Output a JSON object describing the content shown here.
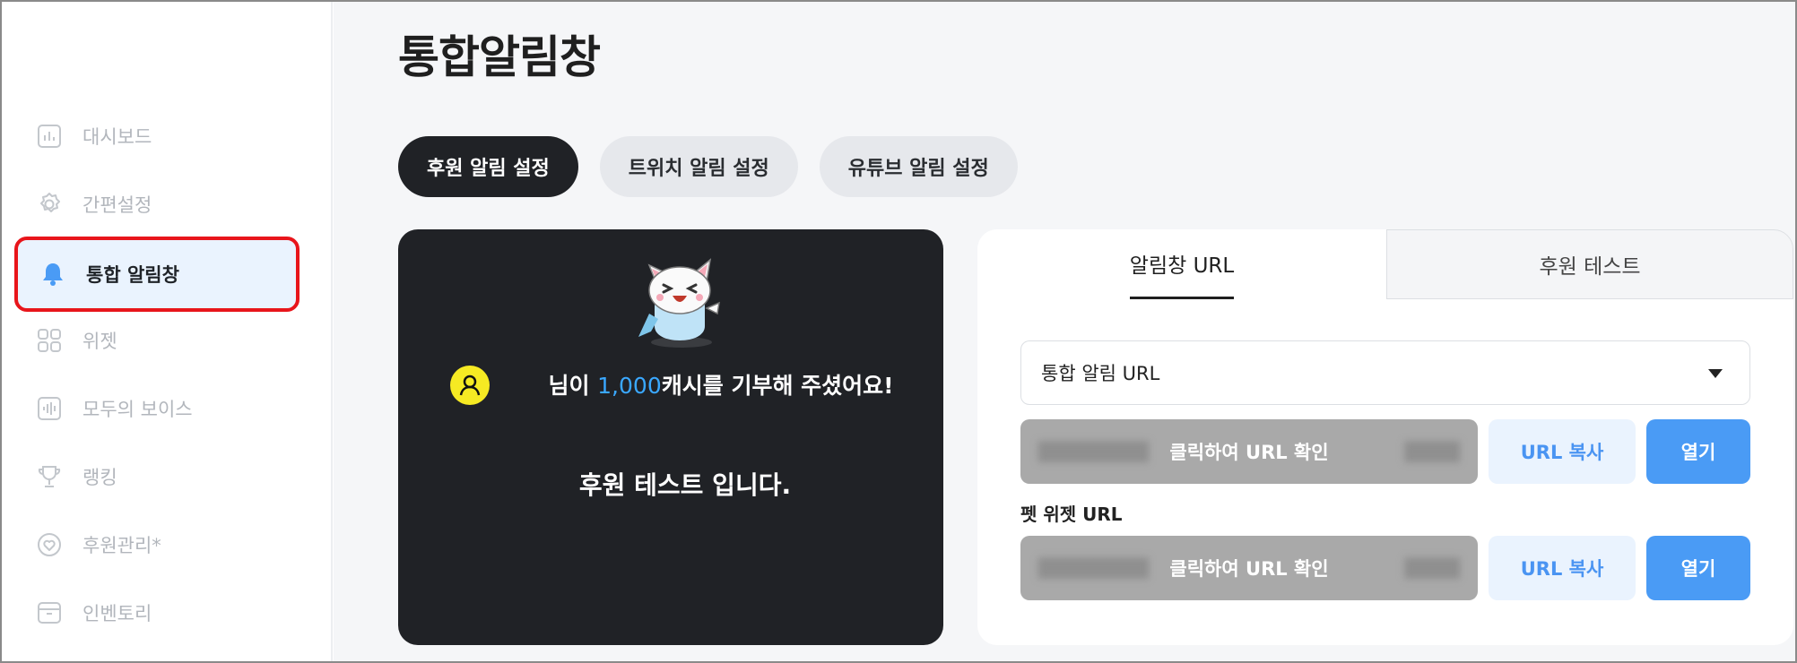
{
  "sidebar": {
    "items": [
      {
        "label": "대시보드",
        "icon": "chart-icon"
      },
      {
        "label": "간편설정",
        "icon": "gear-icon"
      },
      {
        "label": "통합 알림창",
        "icon": "bell-icon",
        "active": true
      },
      {
        "label": "위젯",
        "icon": "grid-icon"
      },
      {
        "label": "모두의 보이스",
        "icon": "audio-wave-icon"
      },
      {
        "label": "랭킹",
        "icon": "trophy-icon"
      },
      {
        "label": "후원관리*",
        "icon": "heart-icon"
      },
      {
        "label": "인벤토리",
        "icon": "box-icon"
      }
    ]
  },
  "main": {
    "title": "통합알림창",
    "tabs": [
      {
        "label": "후원 알림 설정",
        "active": true
      },
      {
        "label": "트위치 알림 설정",
        "active": false
      },
      {
        "label": "유튜브 알림 설정",
        "active": false
      }
    ]
  },
  "preview": {
    "message_prefix": "님이 ",
    "amount": "1,000",
    "message_suffix": "캐시를 기부해 주셨어요!",
    "test_message": "후원 테스트 입니다."
  },
  "panel": {
    "tabs": [
      {
        "label": "알림창 URL",
        "active": true
      },
      {
        "label": "후원 테스트",
        "active": false
      }
    ],
    "select_value": "통합 알림 URL",
    "url_overlay_label": "클릭하여 URL 확인",
    "copy_label": "URL 복사",
    "open_label": "열기",
    "pet_widget_label": "펫 위젯 URL"
  },
  "colors": {
    "accent": "#4a9bf5",
    "active_bg": "#eaf3fe",
    "highlight_border": "#e8151b",
    "dark": "#202226",
    "amount": "#3aa8ff",
    "alert_icon": "#f6ea23"
  }
}
